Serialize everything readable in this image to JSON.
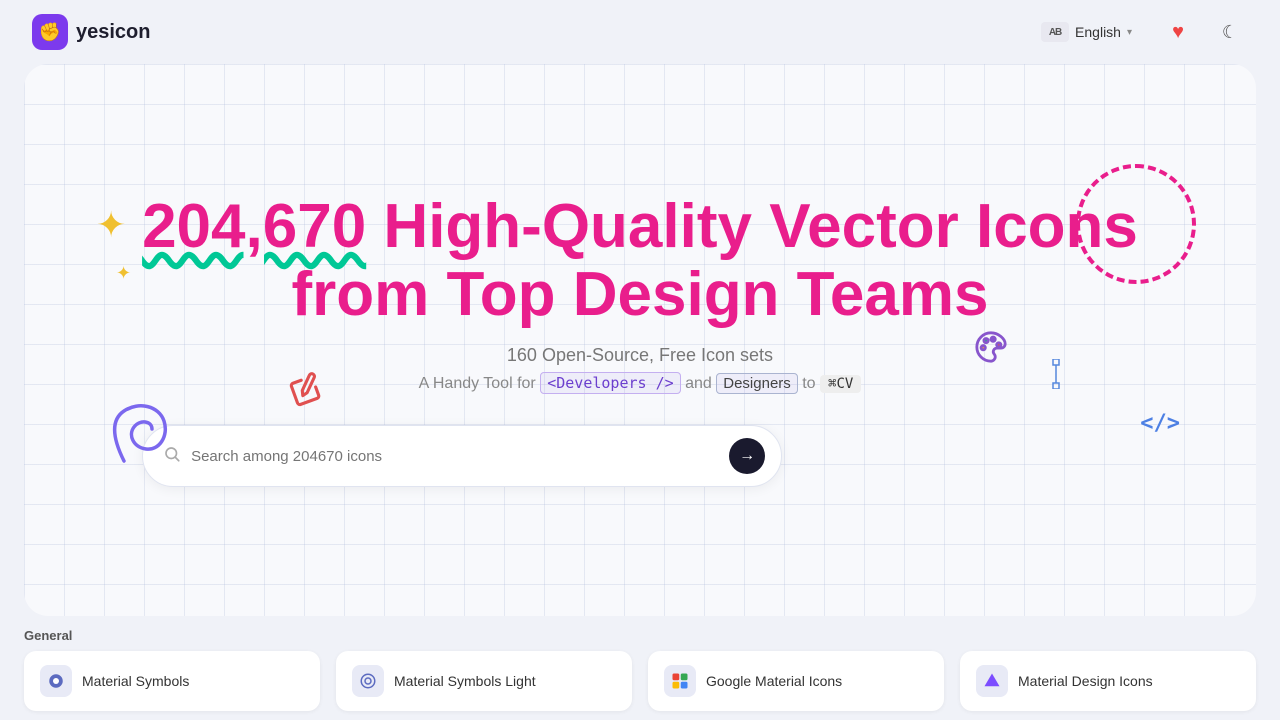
{
  "navbar": {
    "logo_text": "yesicon",
    "logo_emoji": "✊",
    "lang_label": "English",
    "lang_abbr": "AB",
    "heart_icon": "♥",
    "moon_icon": "☾"
  },
  "hero": {
    "icon_count": "204,670",
    "title_part1": " High-Quality Vector Icons",
    "title_line2": "from Top Design Teams",
    "subtitle": "160 Open-Source, Free Icon sets",
    "desc_prefix": "A Handy Tool for",
    "dev_tag": "<Developers />",
    "desc_and": "and",
    "design_tag": "Designers",
    "desc_to": "to",
    "cmd_tag": "⌘CV",
    "search_placeholder": "Search among 204670 icons",
    "search_arrow": "→"
  },
  "decorative": {
    "sparkle": "✦",
    "code_tag": "</>"
  },
  "categories": {
    "label": "General",
    "cards": [
      {
        "name": "Material Symbols",
        "icon": "⬛"
      },
      {
        "name": "Material Symbols Light",
        "icon": "⬜"
      },
      {
        "name": "Google Material Icons",
        "icon": "◉"
      },
      {
        "name": "Material Design Icons",
        "icon": "◈"
      }
    ]
  }
}
